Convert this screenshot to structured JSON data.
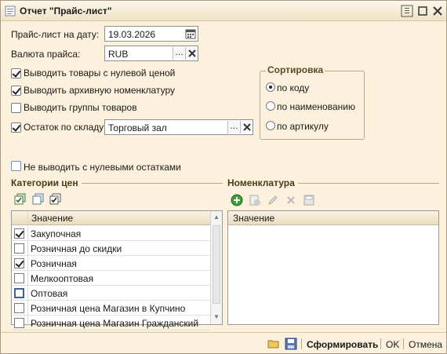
{
  "window": {
    "title": "Отчет \"Прайс-лист\""
  },
  "form": {
    "date_label": "Прайс-лист на дату:",
    "date_value": "19.03.2026",
    "currency_label": "Валюта прайса:",
    "currency_value": "RUB",
    "cb_zero_price": {
      "label": "Выводить товары с нулевой ценой",
      "checked": true
    },
    "cb_archive": {
      "label": "Выводить архивную номенклатуру",
      "checked": true
    },
    "cb_groups": {
      "label": "Выводить группы товаров",
      "checked": false
    },
    "cb_stock": {
      "label": "Остаток по складу",
      "checked": true
    },
    "stock_value": "Торговый зал",
    "cb_no_zero_stock": {
      "label": "Не выводить с нулевыми остатками",
      "checked": false
    }
  },
  "sort": {
    "title": "Сортировка",
    "options": [
      "по коду",
      "по наименованию",
      "по артикулу"
    ],
    "selected": "по коду"
  },
  "price_categories": {
    "title": "Категории цен",
    "column_header": "Значение",
    "rows": [
      {
        "label": "Закупочная",
        "checked": true
      },
      {
        "label": "Розничная до скидки",
        "checked": false
      },
      {
        "label": "Розничная",
        "checked": true
      },
      {
        "label": "Мелкооптовая",
        "checked": false
      },
      {
        "label": "Оптовая",
        "checked": false
      },
      {
        "label": "Розничная цена Магазин в Купчино",
        "checked": false
      },
      {
        "label": "Розничная цена Магазин Гражданский",
        "checked": false
      }
    ]
  },
  "nomenclature": {
    "title": "Номенклатура",
    "column_header": "Значение"
  },
  "footer": {
    "generate": "Сформировать",
    "ok": "OK",
    "cancel": "Отмена"
  },
  "colors": {
    "window_bg": "#fbf1dc",
    "section_title": "#4a3a1a",
    "add_icon": "#3aa03a"
  }
}
